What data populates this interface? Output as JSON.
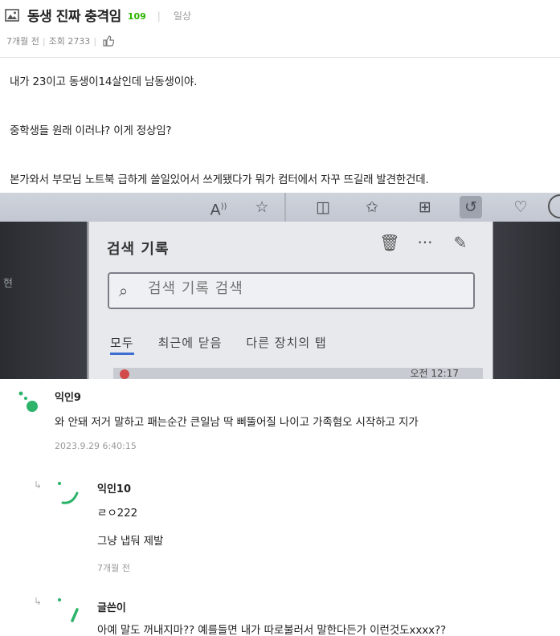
{
  "post": {
    "title": "동생 진짜 충격임",
    "comment_count": "109",
    "board": "일상",
    "time_ago": "7개월 전",
    "views": "조회 2733",
    "body": [
      "내가 23이고 동생이14살인데 남동생이야.",
      "중학생들 원래 이러냐? 이게 정상임?",
      "본가와서 부모님 노트북 급하게 쓸일있어서 쓰게됐다가 뭐가 컴터에서 자꾸 뜨길래 발견한건데."
    ]
  },
  "photo": {
    "left_glyph": "현",
    "panel_title": "검색 기록",
    "search_placeholder": "검색 기록 검색",
    "tabs": [
      "모두",
      "최근에 닫음",
      "다른 장치의 탭"
    ],
    "partial_time": "오전 12:17",
    "toolbar_text": "A",
    "icons": [
      "read-aloud-icon",
      "star-icon",
      "split-screen-icon",
      "favorites-icon",
      "collections-icon",
      "history-icon",
      "health-icon",
      "trash-icon",
      "more-icon",
      "pin-icon",
      "search-icon"
    ]
  },
  "comments": [
    {
      "author": "익인9",
      "text": "와 안돼 저거 말하고 패는순간 큰일남 딱 삐뚤어질 나이고 가족혐오 시작하고 지가",
      "date": "2023.9.29 6:40:15"
    },
    {
      "author": "익인10",
      "lines": [
        "ㄹㅇ222",
        "그냥 냅둬 제발"
      ],
      "date": "7개월 전"
    },
    {
      "author": "글쓴이",
      "text": "아예 말도 꺼내지마?? 예를들면 내가 따로불러서 말한다든가 이런것도xxxx??"
    }
  ],
  "colors": {
    "accent_green": "#2db400",
    "avatar_green": "#2db36a"
  }
}
